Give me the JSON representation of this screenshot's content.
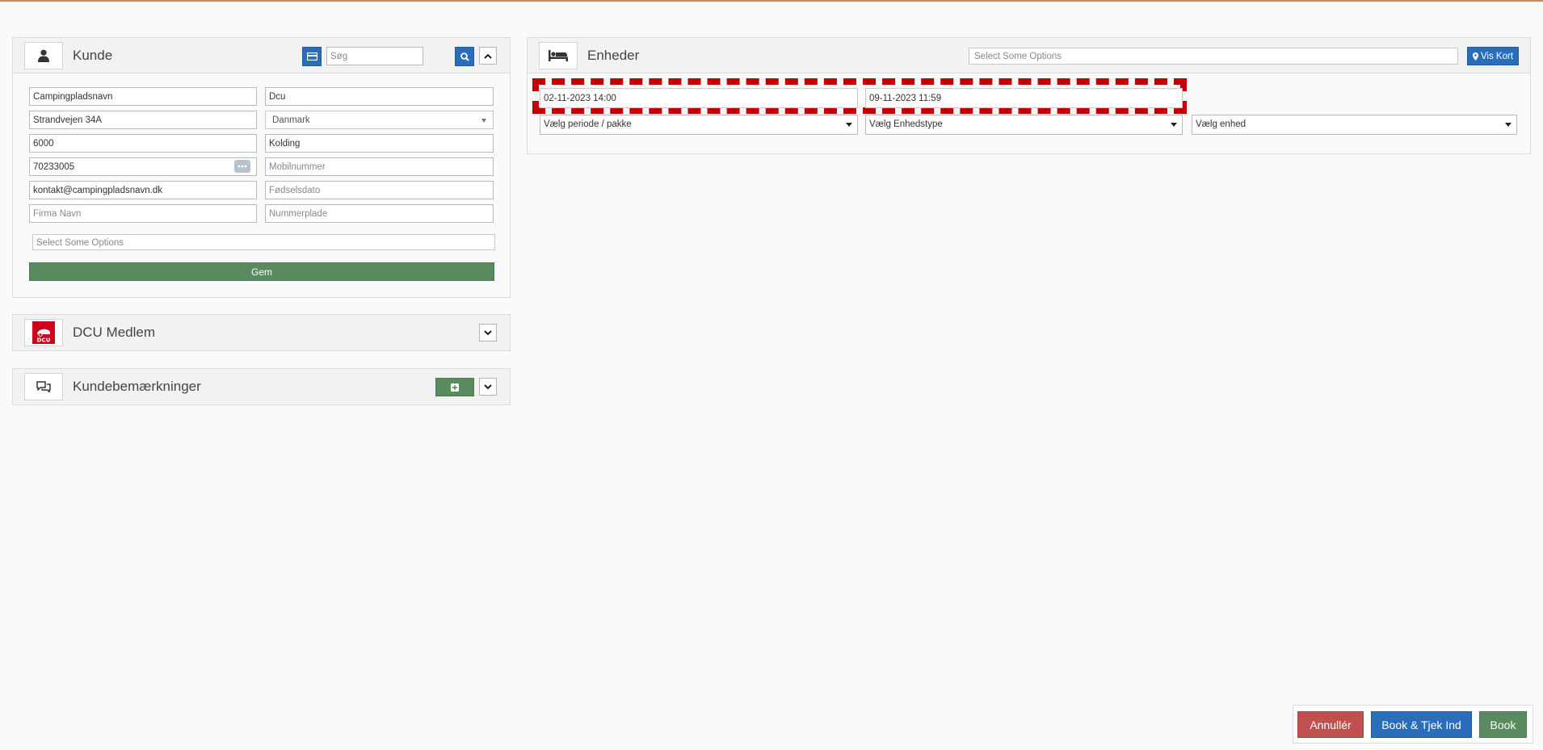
{
  "colors": {
    "accent_blue": "#2a6ebb",
    "green": "#5a8a60",
    "red_cancel": "#c0504d",
    "dcu_red": "#d0021b",
    "highlight_dashed": "#c00000"
  },
  "kunde": {
    "title": "Kunde",
    "search_placeholder": "Søg",
    "fields": {
      "name": "Campingpladsnavn",
      "last": "Dcu",
      "address": "Strandvejen 34A",
      "country": "Danmark",
      "zip": "6000",
      "city": "Kolding",
      "phone": "70233005",
      "mobile_placeholder": "Mobilnummer",
      "email": "kontakt@campingpladsnavn.dk",
      "birth_placeholder": "Fødselsdato",
      "company_placeholder": "Firma Navn",
      "plate_placeholder": "Nummerplade",
      "options_placeholder": "Select Some Options"
    },
    "save_label": "Gem"
  },
  "dcu": {
    "title": "DCU Medlem",
    "logo_text": "DCU"
  },
  "remarks": {
    "title": "Kundebemærkninger"
  },
  "enheder": {
    "title": "Enheder",
    "options_placeholder": "Select Some Options",
    "map_button": "Vis Kort",
    "date_from": "02-11-2023 14:00",
    "date_to": "09-11-2023 11:59",
    "period_select": "Vælg periode / pakke",
    "type_select": "Vælg Enhedstype",
    "unit_select": "Vælg enhed"
  },
  "footer": {
    "cancel": "Annullér",
    "book_checkin": "Book & Tjek Ind",
    "book": "Book"
  }
}
